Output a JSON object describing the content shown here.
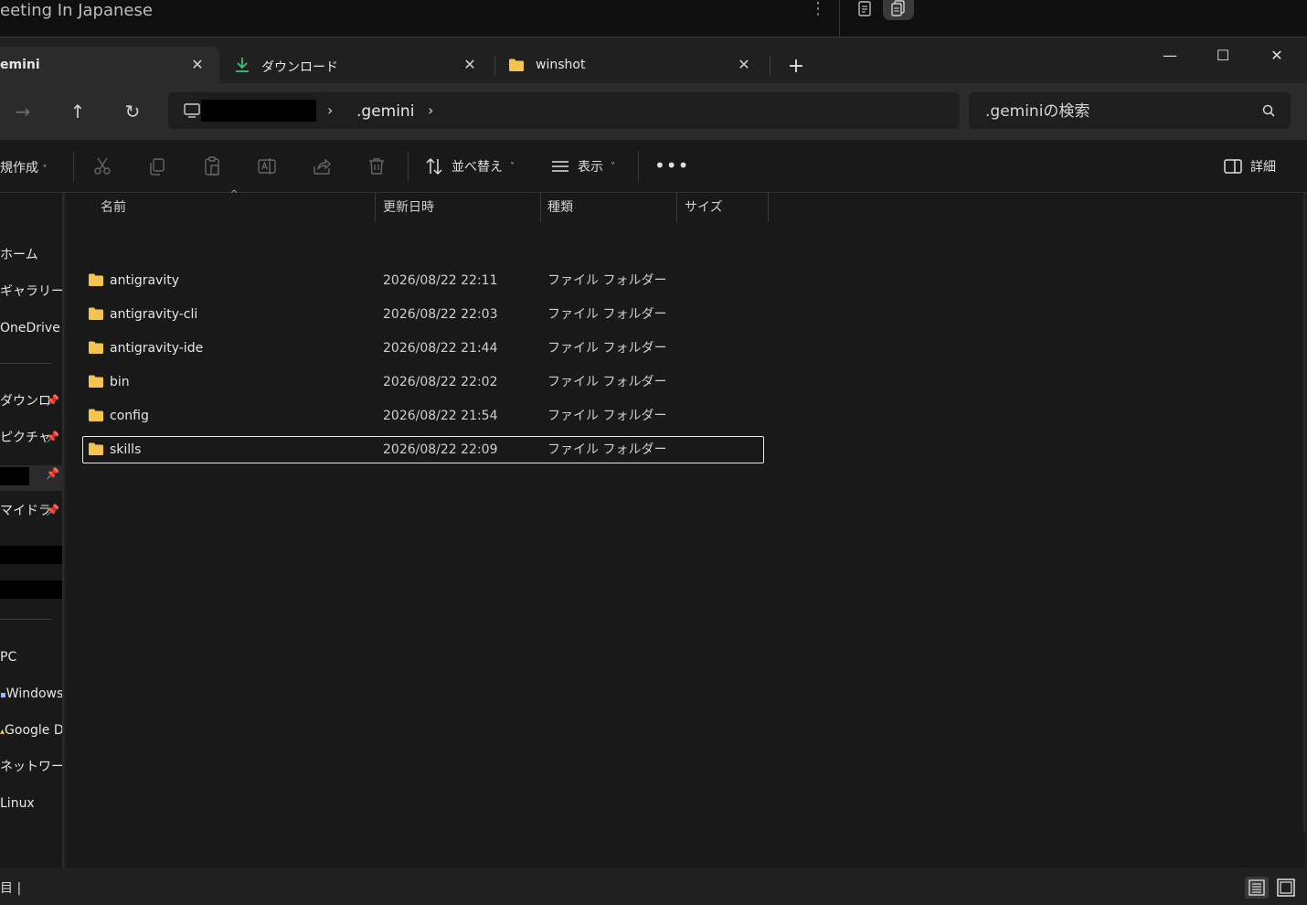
{
  "background_app": {
    "title": "eeting In Japanese"
  },
  "tabs": [
    {
      "label": "emini",
      "icon": "folder-icon"
    },
    {
      "label": "ダウンロード",
      "icon": "download-icon"
    },
    {
      "label": "winshot",
      "icon": "folder-icon"
    }
  ],
  "window_controls": {
    "minimize": "—",
    "maximize": "☐",
    "close": "✕"
  },
  "address": {
    "current_folder": ".gemini"
  },
  "search": {
    "placeholder": ".geminiの検索"
  },
  "commandbar": {
    "new_label": "規作成",
    "sort_label": "並べ替え",
    "view_label": "表示",
    "more_label": "•••",
    "details_label": "詳細"
  },
  "navpane": {
    "items": [
      {
        "label": "ホーム"
      },
      {
        "label": "ギャラリー"
      },
      {
        "label": "OneDrive"
      },
      {
        "label": "ダウンロ-",
        "pinned": true
      },
      {
        "label": "ピクチャ",
        "pinned": true
      },
      {
        "label": "",
        "pinned": true
      },
      {
        "label": "マイドラ-",
        "pinned": true
      },
      {
        "label": "PC"
      },
      {
        "label": "Windows"
      },
      {
        "label": "Google D"
      },
      {
        "label": "ネットワーク"
      },
      {
        "label": "Linux"
      }
    ]
  },
  "columns": {
    "name": "名前",
    "date": "更新日時",
    "type": "種類",
    "size": "サイズ"
  },
  "files": [
    {
      "name": "antigravity",
      "date": "2026/08/22 22:11",
      "type": "ファイル フォルダー"
    },
    {
      "name": "antigravity-cli",
      "date": "2026/08/22 22:03",
      "type": "ファイル フォルダー"
    },
    {
      "name": "antigravity-ide",
      "date": "2026/08/22 21:44",
      "type": "ファイル フォルダー"
    },
    {
      "name": "bin",
      "date": "2026/08/22 22:02",
      "type": "ファイル フォルダー"
    },
    {
      "name": "config",
      "date": "2026/08/22 21:54",
      "type": "ファイル フォルダー"
    },
    {
      "name": "skills",
      "date": "2026/08/22 22:09",
      "type": "ファイル フォルダー",
      "selected": true
    }
  ],
  "status": {
    "text": "目 |"
  },
  "colors": {
    "folder": "#f4c44e",
    "accent_download": "#3ec07a",
    "background": "#191919"
  }
}
